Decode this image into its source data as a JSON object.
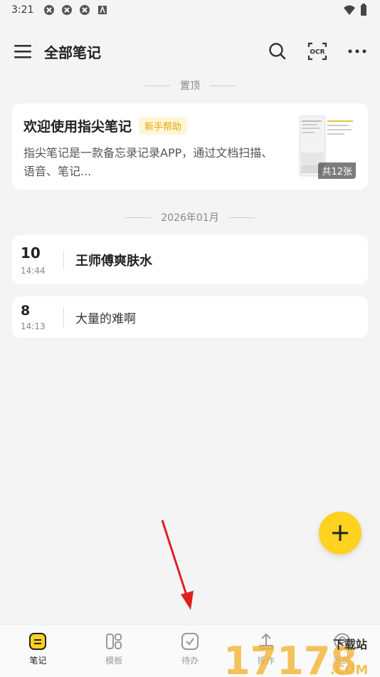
{
  "status_bar": {
    "time": "3:21",
    "icons": [
      "app-notification-icon",
      "app-notification-icon",
      "app-notification-icon",
      "keyboard-icon"
    ],
    "right_icons": [
      "wifi-icon",
      "battery-icon"
    ]
  },
  "header": {
    "title": "全部笔记",
    "menu_icon": "menu-icon",
    "search_icon": "search-icon",
    "ocr_label": "OCR",
    "more_icon": "more-icon"
  },
  "pinned_section": {
    "label": "置顶",
    "card": {
      "title": "欢迎使用指尖笔记",
      "tag": "新手帮助",
      "text": "指尖笔记是一款备忘录记录APP，通过文档扫描、语音、笔记...",
      "image_count": "共12张"
    }
  },
  "month_section": {
    "label": "2026年01月",
    "notes": [
      {
        "day": "10",
        "time": "14:44",
        "title": "王师傅爽肤水"
      },
      {
        "day": "8",
        "time": "14:13",
        "title": "大量的难啊"
      }
    ]
  },
  "fab": {
    "icon": "plus-icon"
  },
  "bottom_nav": {
    "items": [
      {
        "label": "笔记",
        "icon": "note-icon",
        "active": true
      },
      {
        "label": "模板",
        "icon": "template-icon",
        "active": false
      },
      {
        "label": "待办",
        "icon": "todo-icon",
        "active": false
      },
      {
        "label": "操作",
        "icon": "action-icon",
        "active": false
      },
      {
        "label": "我的",
        "icon": "profile-icon",
        "active": false
      }
    ]
  },
  "watermark": {
    "text_top": "下载站",
    "text_main": "17178",
    "text_domain": ".COM"
  },
  "colors": {
    "accent": "#ffd21f",
    "tag_bg": "#fff6d6",
    "tag_text": "#e0a800",
    "arrow": "#e02020"
  }
}
